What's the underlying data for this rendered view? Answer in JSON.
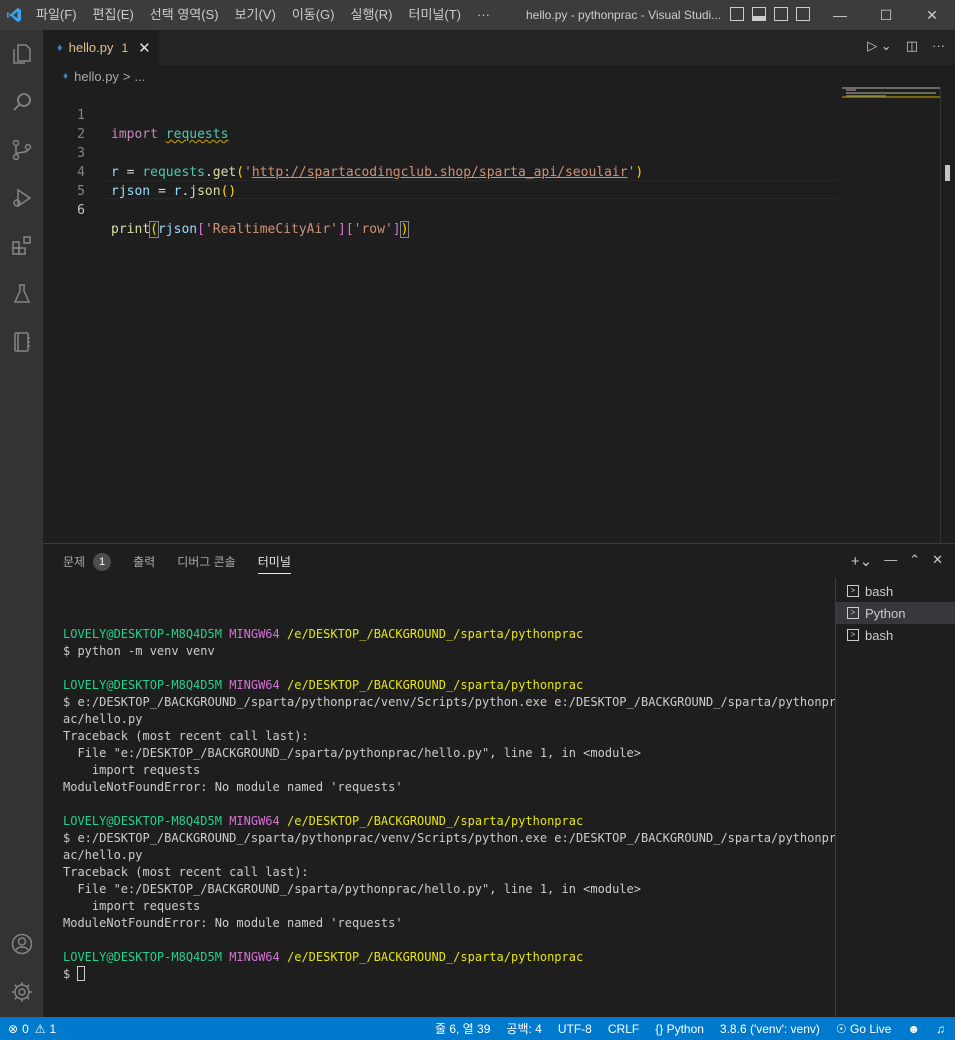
{
  "titlebar": {
    "menu": [
      "파일(F)",
      "편집(E)",
      "선택 영역(S)",
      "보기(V)",
      "이동(G)",
      "실행(R)",
      "터미널(T)",
      "···"
    ],
    "title": "hello.py - pythonprac - Visual Studi..."
  },
  "tab": {
    "name": "hello.py",
    "problems": "1"
  },
  "breadcrumb": {
    "file": "hello.py",
    "sep": ">",
    "more": "..."
  },
  "editor": {
    "line_numbers": [
      "1",
      "2",
      "3",
      "4",
      "5",
      "6"
    ],
    "active_line": 6,
    "code": {
      "l1_kw": "import",
      "l1_mod": "requests",
      "l3_var": "r",
      "l3_eq": " = ",
      "l3_obj": "requests",
      "l3_dot": ".",
      "l3_fn": "get",
      "l3_open": "(",
      "l3_q1": "'",
      "l3_url": "http://spartacodingclub.shop/sparta_api/seoulair",
      "l3_q2": "'",
      "l3_close": ")",
      "l4_var": "rjson",
      "l4_eq": " = ",
      "l4_obj": "r",
      "l4_dot": ".",
      "l4_fn": "json",
      "l4_paren": "()",
      "l6_fn": "print",
      "l6_open": "(",
      "l6_var": "rjson",
      "l6_b1o": "[",
      "l6_s1": "'RealtimeCityAir'",
      "l6_b1c": "]",
      "l6_b2o": "[",
      "l6_s2": "'row'",
      "l6_b2c": "]",
      "l6_close": ")"
    }
  },
  "panel": {
    "tabs": {
      "problems": "문제",
      "problems_count": "1",
      "output": "출력",
      "debug": "디버그 콘솔",
      "terminal": "터미널"
    },
    "terminal_lines": {
      "user": "LOVELY@DESKTOP-M8Q4D5M",
      "shell": "MINGW64",
      "path": "/e/DESKTOP_/BACKGROUND_/sparta/pythonprac",
      "cmd1": "$ python -m venv venv",
      "cmd2a": "$ e:/DESKTOP_/BACKGROUND_/sparta/pythonprac/venv/Scripts/python.exe e:/DESKTOP_/BACKGROUND_/sparta/pythonpr",
      "cmd2b": "ac/hello.py",
      "tb1": "Traceback (most recent call last):",
      "tb2": "  File \"e:/DESKTOP_/BACKGROUND_/sparta/pythonprac/hello.py\", line 1, in <module>",
      "tb3": "    import requests",
      "tb4": "ModuleNotFoundError: No module named 'requests'",
      "prompt": "$ "
    },
    "terminals": [
      "bash",
      "Python",
      "bash"
    ]
  },
  "statusbar": {
    "errors": "0",
    "warnings": "1",
    "position": "줄 6, 열 39",
    "spaces": "공백: 4",
    "encoding": "UTF-8",
    "eol": "CRLF",
    "language": "Python",
    "interpreter": "3.8.6 ('venv': venv)",
    "live": "Go Live"
  },
  "colors": {
    "statusbar": "#007acc",
    "activitybar": "#333333",
    "editor_bg": "#1e1e1e",
    "titlebar": "#3c3c3c"
  }
}
